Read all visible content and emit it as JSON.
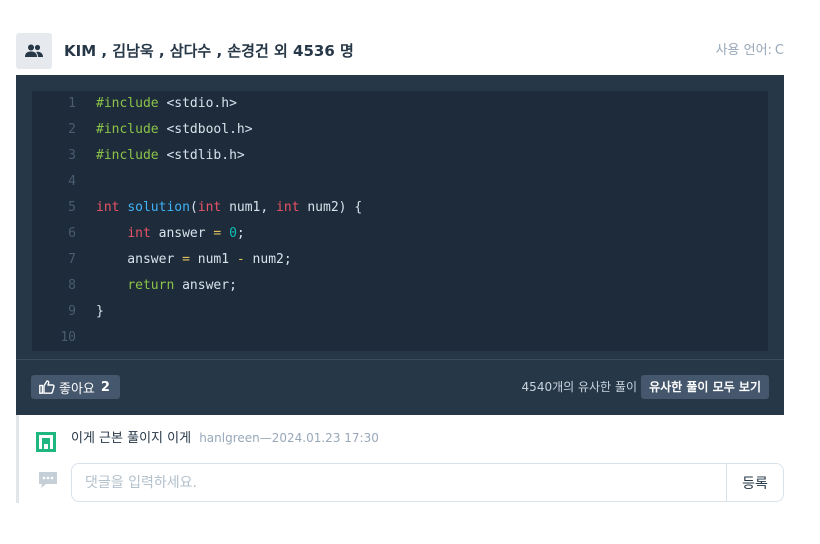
{
  "header": {
    "authors": "KIM , 김남욱 , 삼다수 , 손경건 외 4536 명",
    "language_label": "사용 언어:",
    "language_value": "C"
  },
  "icons": {
    "avatar": "users-icon",
    "like": "thumbs-up-icon",
    "comment_avatar": "pixel-avatar-icon",
    "comment_input": "speech-bubble-icon"
  },
  "code": {
    "lines": [
      {
        "n": "1",
        "tokens": [
          {
            "t": "#include",
            "c": "pre"
          },
          {
            "t": " <stdio.h>",
            "c": ""
          }
        ]
      },
      {
        "n": "2",
        "tokens": [
          {
            "t": "#include",
            "c": "pre"
          },
          {
            "t": " <stdbool.h>",
            "c": ""
          }
        ]
      },
      {
        "n": "3",
        "tokens": [
          {
            "t": "#include",
            "c": "pre"
          },
          {
            "t": " <stdlib.h>",
            "c": ""
          }
        ]
      },
      {
        "n": "4",
        "tokens": []
      },
      {
        "n": "5",
        "tokens": [
          {
            "t": "int",
            "c": "kw"
          },
          {
            "t": " ",
            "c": ""
          },
          {
            "t": "solution",
            "c": "fn"
          },
          {
            "t": "(",
            "c": ""
          },
          {
            "t": "int",
            "c": "kw"
          },
          {
            "t": " num1, ",
            "c": ""
          },
          {
            "t": "int",
            "c": "kw"
          },
          {
            "t": " num2) {",
            "c": ""
          }
        ]
      },
      {
        "n": "6",
        "tokens": [
          {
            "t": "    ",
            "c": ""
          },
          {
            "t": "int",
            "c": "kw"
          },
          {
            "t": " answer ",
            "c": ""
          },
          {
            "t": "=",
            "c": "op"
          },
          {
            "t": " ",
            "c": ""
          },
          {
            "t": "0",
            "c": "num"
          },
          {
            "t": ";",
            "c": ""
          }
        ]
      },
      {
        "n": "7",
        "tokens": [
          {
            "t": "    answer ",
            "c": ""
          },
          {
            "t": "=",
            "c": "op"
          },
          {
            "t": " num1 ",
            "c": ""
          },
          {
            "t": "-",
            "c": "op"
          },
          {
            "t": " num2;",
            "c": ""
          }
        ]
      },
      {
        "n": "8",
        "tokens": [
          {
            "t": "    ",
            "c": ""
          },
          {
            "t": "return",
            "c": "ret"
          },
          {
            "t": " answer;",
            "c": ""
          }
        ]
      },
      {
        "n": "9",
        "tokens": [
          {
            "t": "}",
            "c": ""
          }
        ]
      },
      {
        "n": "10",
        "tokens": []
      }
    ]
  },
  "footer": {
    "like_label": "좋아요",
    "like_count": "2",
    "similar_count_text": "4540개의 유사한 풀이",
    "similar_button": "유사한 풀이 모두 보기"
  },
  "comment": {
    "text": "이게 근본 풀이지 이게",
    "meta": "hanlgreen—2024.01.23 17:30",
    "input_placeholder": "댓글을 입력하세요.",
    "submit_label": "등록"
  },
  "colors": {
    "code_bg": "#1e2b3a",
    "card_bg": "#263747",
    "keyword": "#e85466",
    "function": "#3eb3f7",
    "preprocessor": "#8bc34a",
    "number": "#0fbfb4",
    "operator": "#e0c15c",
    "comment_avatar": "#1eb780"
  }
}
